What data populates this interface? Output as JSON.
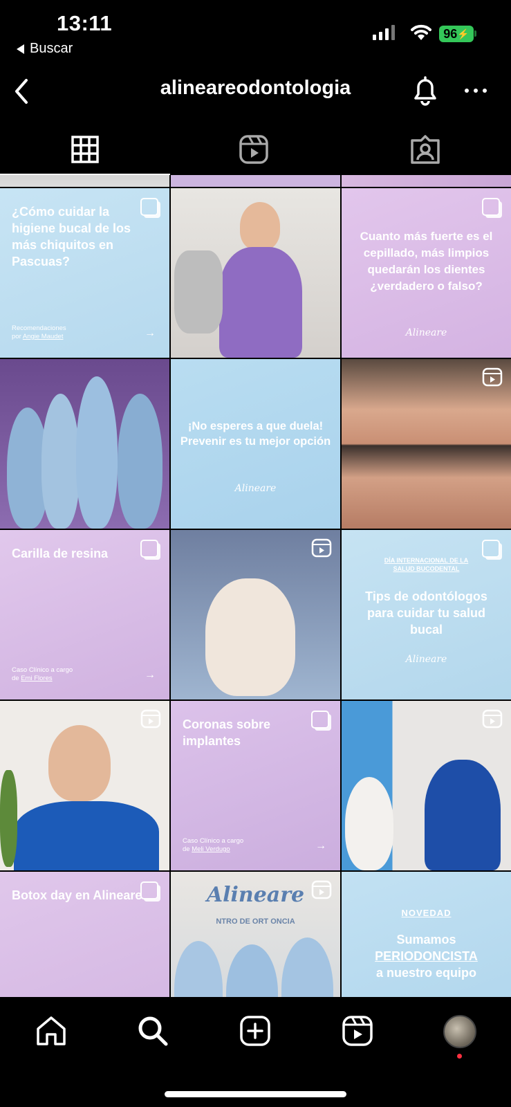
{
  "status": {
    "time": "13:11",
    "back_app": "Buscar",
    "battery": "96"
  },
  "header": {
    "username": "alineareodontologia"
  },
  "tabs": [
    "grid",
    "reels",
    "tagged"
  ],
  "posts": [
    {
      "title": "¿Cómo cuidar la higiene bucal de los más chiquitos en Pascuas?",
      "caption_1": "Recomendaciones",
      "caption_2_prefix": "por ",
      "caption_2_name": "Angie Maudet"
    },
    {
      "alt": "dentist in purple scrubs"
    },
    {
      "title": "Cuanto más fuerte es el cepillado, más limpios quedarán los dientes ¿verdadero o falso?",
      "brand": "Alineare"
    },
    {
      "alt": "team photo"
    },
    {
      "title": "¡No esperes a que duela! Prevenir es tu mejor opción",
      "brand": "Alineare"
    },
    {
      "alt": "smile before and after"
    },
    {
      "title": "Carilla de resina",
      "caption_1": "Caso Clínico a cargo",
      "caption_2_prefix": "de ",
      "caption_2_name": "Emi Flores"
    },
    {
      "alt": "gloved hand holding retainer"
    },
    {
      "kicker": "DÍA INTERNACIONAL DE LA SALUD BUCODENTAL",
      "title": "Tips de odontólogos para cuidar tu salud bucal",
      "brand": "Alineare"
    },
    {
      "alt": "dentist portrait"
    },
    {
      "title": "Coronas sobre implantes",
      "caption_1": "Caso Clínico a cargo",
      "caption_2_prefix": "de ",
      "caption_2_name": "Meli Verdugo"
    },
    {
      "alt": "two dentists talking"
    },
    {
      "title": "Botox day en Alineare"
    },
    {
      "sign": "Alineare",
      "sign_sub": "NTRO DE ORT  ONCIA"
    },
    {
      "kicker": "NOVEDAD",
      "line1": "Sumamos",
      "line2": "PERIODONCISTA",
      "line3": "a nuestro equipo"
    }
  ],
  "colors": {
    "lilac": "#dcc3e8",
    "sky": "#bfe0f2",
    "green": "#34c759",
    "notif": "#ff3040"
  }
}
